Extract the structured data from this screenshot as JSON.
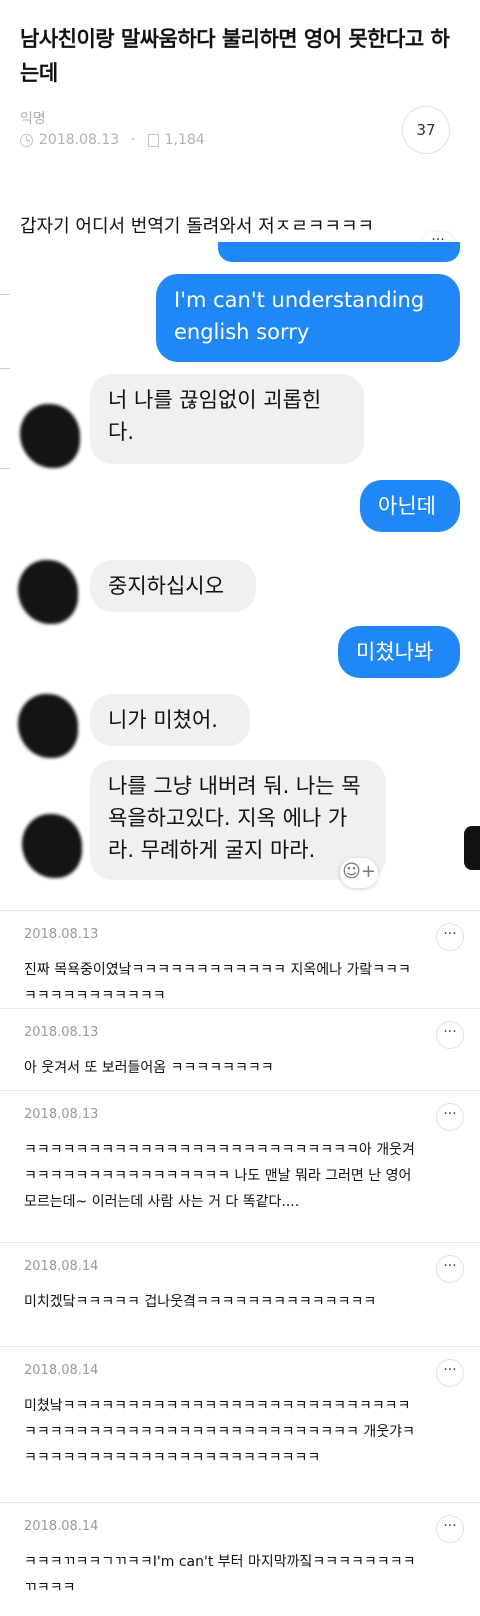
{
  "post": {
    "title": "남사친이랑 말싸움하다 불리하면 영어 못한다고 하는데",
    "author": "익명",
    "date": "2018.08.13",
    "views": "1,184",
    "comment_count": "37",
    "meta_separator": "·"
  },
  "chat": {
    "intro_caption": "갑자기 어디서 번역기 돌려와서 저ㅈㄹㅋㅋㅋㅋ",
    "more_label": "···",
    "emoji_reaction": "☺+",
    "messages": [
      {
        "side": "right",
        "text": "I'm can't understanding english sorry"
      },
      {
        "side": "left",
        "text": "너 나를 끊임없이 괴롭힌다."
      },
      {
        "side": "right",
        "text": "아닌데"
      },
      {
        "side": "left",
        "text": "중지하십시오"
      },
      {
        "side": "right",
        "text": "미쳤나봐"
      },
      {
        "side": "left",
        "text": "니가 미쳤어."
      },
      {
        "side": "left",
        "text": "나를 그냥 내버려 둬. 나는 목욕을하고있다. 지옥 에나 가라. 무례하게 굴지 마라."
      }
    ]
  },
  "comments": [
    {
      "date": "2018.08.13",
      "text": "진짜 목욕중이였낰ㅋㅋㅋㅋㅋㅋㅋㅋㅋㅋㅋㅋ 지옥에나 가랔ㅋㅋㅋㅋㅋㅋㅋㅋㅋㅋㅋㅋㅋㅋ",
      "more": "···"
    },
    {
      "date": "2018.08.13",
      "text": "아 웃겨서 또 보러들어옴 ㅋㅋㅋㅋㅋㅋㅋㅋ",
      "more": "···"
    },
    {
      "date": "2018.08.13",
      "text": "ㅋㅋㅋㅋㅋㅋㅋㅋㅋㅋㅋㅋㅋㅋㅋㅋㅋㅋㅋㅋㅋㅋㅋㅋㅋㅋ아 개웃겨ㅋㅋㅋㅋㅋㅋㅋㅋㅋㅋㅋㅋㅋㅋㅋㅋ 나도 맨날 뭐라 그러면 난 영어 모르는데~ 이러는데 사람 사는 거 다 똑같다....",
      "more": "···"
    },
    {
      "date": "2018.08.14",
      "text": "미치겠닼ㅋㅋㅋㅋㅋ 겁나웃곀ㅋㅋㅋㅋㅋㅋㅋㅋㅋㅋㅋㅋㅋㅋ",
      "more": "···"
    },
    {
      "date": "2018.08.14",
      "text": "미쳤낰ㅋㅋㅋㅋㅋㅋㅋㅋㅋㅋㅋㅋㅋㅋㅋㅋㅋㅋㅋㅋㅋㅋㅋㅋㅋㅋㅋㅋㅋㅋㅋㅋㅋㅋㅋㅋㅋㅋㅋㅋㅋㅋㅋㅋㅋㅋㅋㅋㅋㅋㅋㅋㅋ 개웃갸ㅋㅋㅋㅋㅋㅋㅋㅋㅋㅋㅋㅋㅋㅋㅋㅋㅋㅋㅋㅋㅋㅋㅋㅋ",
      "more": "···"
    },
    {
      "date": "2018.08.14",
      "text": "ㅋㅋㅋㄲㅋㅋㄱㄲㅋㅋI'm can't 부터 마지막까짘ㅋㅋㅋㅋㅋㅋㅋㅋㄲㅋㅋㅋ",
      "more": "···"
    }
  ],
  "colors": {
    "accent": "#1f88f6",
    "received": "#f0f0f0"
  },
  "icons": [
    "clock-icon",
    "document-icon",
    "more-icon",
    "emoji-add-icon"
  ]
}
